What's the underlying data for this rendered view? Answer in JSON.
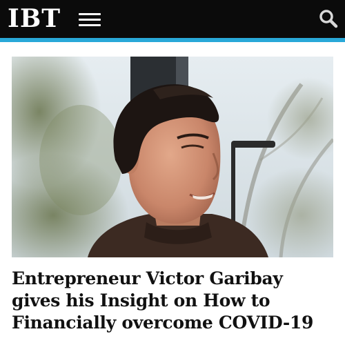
{
  "header": {
    "logo_text": "IBT",
    "menu_icon": "hamburger-menu-icon",
    "search_icon": "search-icon",
    "background_color": "#0b0b0b",
    "accent_color": "#29a8d8"
  },
  "article": {
    "headline": "Entrepreneur Victor Garibay gives his Insight on How to Financially overcome COVID-19"
  }
}
